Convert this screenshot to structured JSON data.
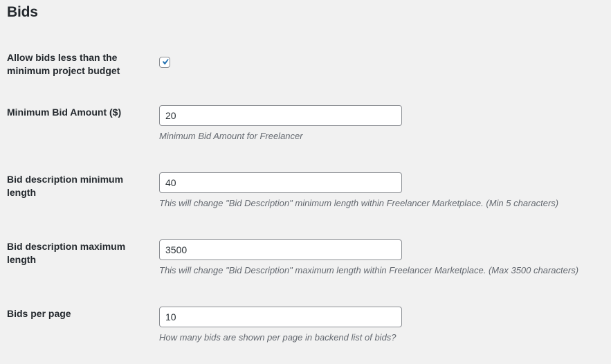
{
  "section": {
    "title": "Bids"
  },
  "settings": {
    "allow_less": {
      "label_line1": "Allow bids less than the",
      "label_line2": "minimum project budget",
      "checked": true
    },
    "min_bid": {
      "label": "Minimum Bid Amount ($)",
      "value": "20",
      "description": "Minimum Bid Amount for Freelancer"
    },
    "desc_min": {
      "label_line1": "Bid description minimum",
      "label_line2": "length",
      "value": "40",
      "description": "This will change \"Bid Description\" minimum length within Freelancer Marketplace. (Min 5 characters)"
    },
    "desc_max": {
      "label_line1": "Bid description maximum",
      "label_line2": "length",
      "value": "3500",
      "description": "This will change \"Bid Description\" maximum length within Freelancer Marketplace. (Max 3500 characters)"
    },
    "per_page": {
      "label": "Bids per page",
      "value": "10",
      "description": "How many bids are shown per page in backend list of bids?"
    }
  },
  "colors": {
    "background": "#f1f1f1",
    "text": "#23282d",
    "description": "#646970",
    "input_border": "#8c8f94",
    "checkmark": "#2271b1"
  },
  "icons": {
    "checkmark": "checkmark-icon"
  }
}
